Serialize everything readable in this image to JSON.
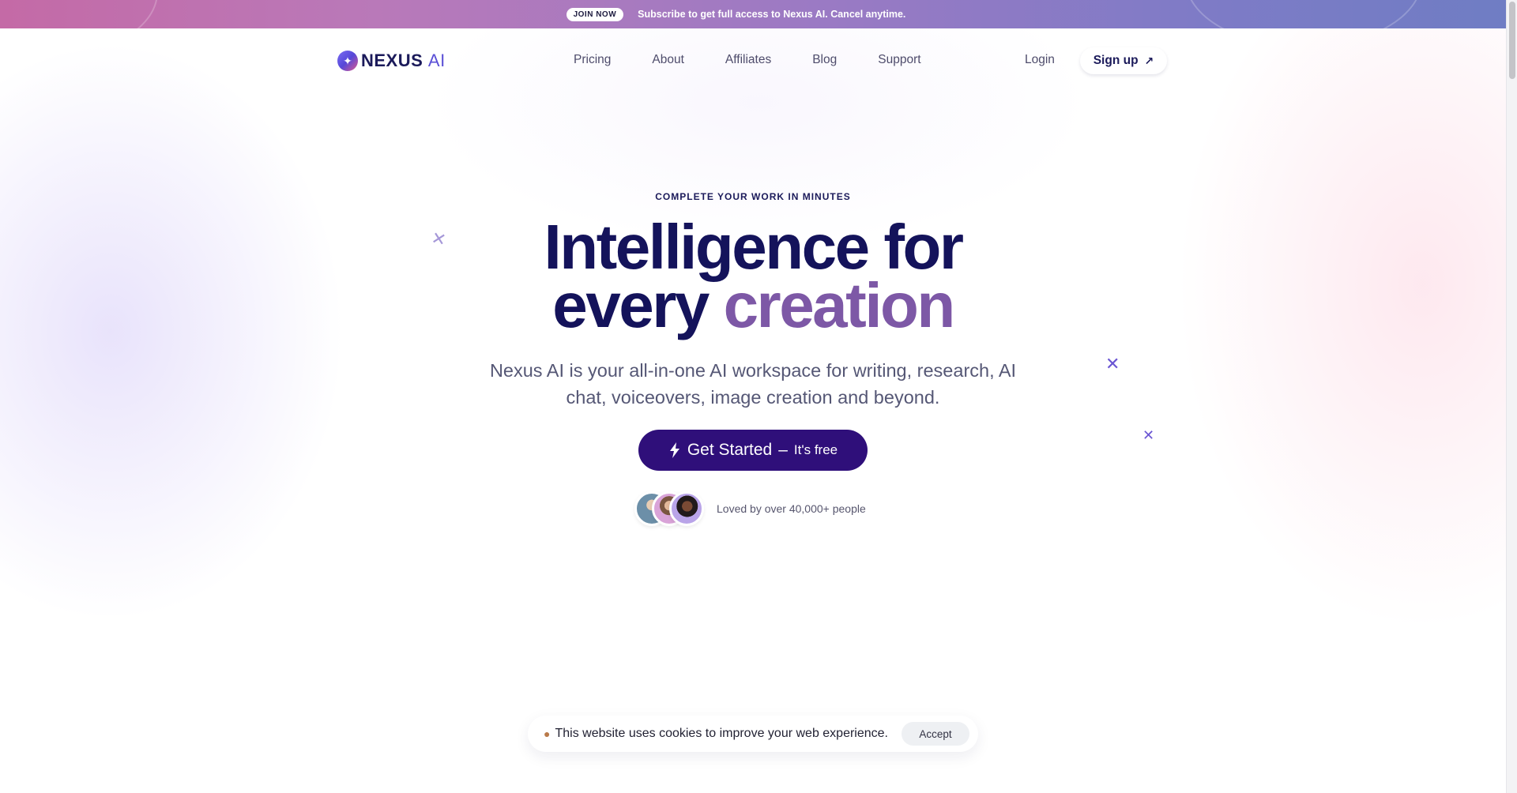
{
  "banner": {
    "pill_label": "JOIN NOW",
    "text": "Subscribe to get full access to Nexus AI. Cancel anytime."
  },
  "nav": {
    "logo_text": "NEXUS",
    "logo_suffix": "AI",
    "links": [
      "Pricing",
      "About",
      "Affiliates",
      "Blog",
      "Support"
    ],
    "login": "Login",
    "signup": "Sign up"
  },
  "hero": {
    "eyebrow": "COMPLETE YOUR WORK IN MINUTES",
    "headline_line1": "Intelligence for",
    "headline_line2_plain": "every",
    "headline_line2_accent": "creation",
    "subhead": "Nexus AI is your all-in-one AI workspace for writing, research, AI chat, voiceovers, image creation and beyond.",
    "cta_label": "Get Started",
    "cta_dash": "–",
    "cta_free": "It's free",
    "social_proof": "Loved by over 40,000+ people"
  },
  "cookie": {
    "text": "This website uses cookies to improve your web experience.",
    "accept": "Accept"
  },
  "icons": {
    "logo": "sparkle-logo-icon",
    "signup": "arrow-up-right-icon",
    "cta": "lightning-bolt-icon",
    "cookie": "cookie-icon",
    "decor": "cross-icon"
  },
  "colors": {
    "brand_navy": "#14135b",
    "accent_purple": "#7d58a6",
    "cta_bg": "#2f0f7a",
    "banner_start": "#c46aa6",
    "banner_end": "#6f7dc4"
  }
}
